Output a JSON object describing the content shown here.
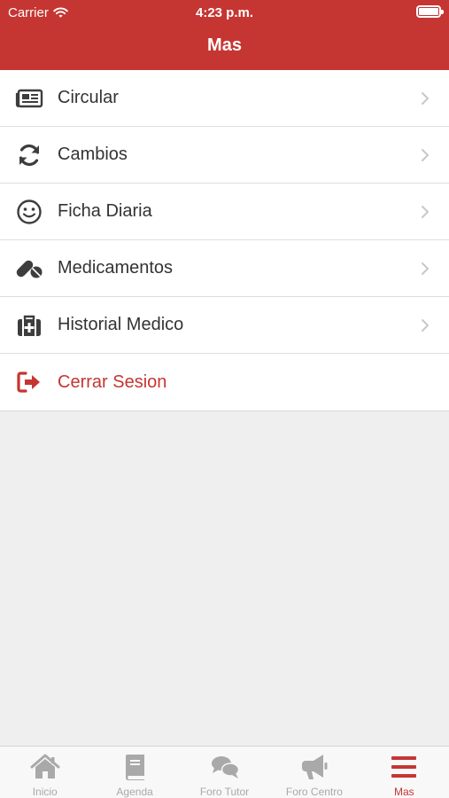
{
  "status_bar": {
    "carrier": "Carrier",
    "time": "4:23 p.m."
  },
  "header": {
    "title": "Mas"
  },
  "menu": {
    "items": [
      {
        "label": "Circular",
        "icon": "newspaper-icon"
      },
      {
        "label": "Cambios",
        "icon": "refresh-icon"
      },
      {
        "label": "Ficha Diaria",
        "icon": "smiley-icon"
      },
      {
        "label": "Medicamentos",
        "icon": "pills-icon"
      },
      {
        "label": "Historial Medico",
        "icon": "medkit-icon"
      },
      {
        "label": "Cerrar Sesion",
        "icon": "sign-out-icon"
      }
    ]
  },
  "tabbar": {
    "tabs": [
      {
        "label": "Inicio",
        "icon": "home-icon"
      },
      {
        "label": "Agenda",
        "icon": "book-icon"
      },
      {
        "label": "Foro Tutor",
        "icon": "chat-bubbles-icon"
      },
      {
        "label": "Foro Centro",
        "icon": "megaphone-icon"
      },
      {
        "label": "Mas",
        "icon": "menu-icon",
        "active": true
      }
    ]
  },
  "colors": {
    "brand": "#c53632",
    "icon_dark": "#3d3d3d",
    "inactive": "#a9a9a9",
    "background": "#efefef"
  }
}
